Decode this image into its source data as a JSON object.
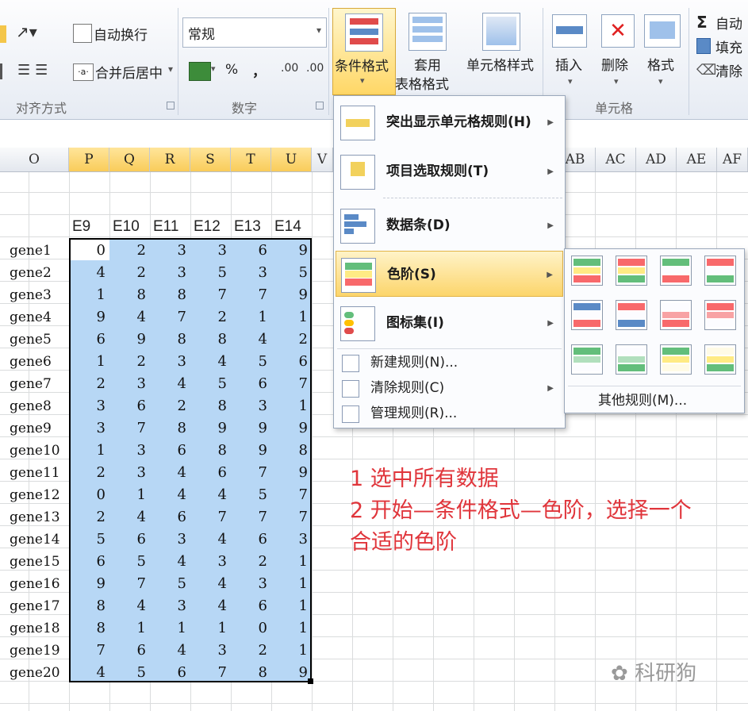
{
  "ribbon": {
    "auto_wrap": "自动换行",
    "merge_center": "合并后居中",
    "merge_arrow": "▾",
    "number_format": "常规",
    "percent": "%",
    "comma": "，",
    "inc_decimal": ".00",
    "dec_decimal": ".00",
    "conditional_format": "条件格式",
    "table_format_line1": "套用",
    "table_format_line2": "表格格式",
    "cell_style": "单元格样式",
    "insert": "插入",
    "delete": "删除",
    "format": "格式",
    "autosum": "自动",
    "fill": "填充",
    "clear": "清除",
    "group_alignment": "对齐方式",
    "group_number": "数字",
    "group_cells": "单元格"
  },
  "columns": [
    "O",
    "P",
    "Q",
    "R",
    "S",
    "T",
    "U",
    "V",
    "AB",
    "AC",
    "AD",
    "AE",
    "AF"
  ],
  "headers": [
    "E9",
    "E10",
    "E11",
    "E12",
    "E13",
    "E14"
  ],
  "rows": [
    {
      "gene": "gene1",
      "values": [
        0,
        2,
        3,
        3,
        6,
        9
      ]
    },
    {
      "gene": "gene2",
      "values": [
        4,
        2,
        3,
        5,
        3,
        5
      ]
    },
    {
      "gene": "gene3",
      "values": [
        1,
        8,
        8,
        7,
        7,
        9
      ]
    },
    {
      "gene": "gene4",
      "values": [
        9,
        4,
        7,
        2,
        1,
        1
      ]
    },
    {
      "gene": "gene5",
      "values": [
        6,
        9,
        8,
        8,
        4,
        2
      ]
    },
    {
      "gene": "gene6",
      "values": [
        1,
        2,
        3,
        4,
        5,
        6
      ]
    },
    {
      "gene": "gene7",
      "values": [
        2,
        3,
        4,
        5,
        6,
        7
      ]
    },
    {
      "gene": "gene8",
      "values": [
        3,
        6,
        2,
        8,
        3,
        1
      ]
    },
    {
      "gene": "gene9",
      "values": [
        3,
        7,
        8,
        9,
        9,
        9
      ]
    },
    {
      "gene": "gene10",
      "values": [
        1,
        3,
        6,
        8,
        9,
        8
      ]
    },
    {
      "gene": "gene11",
      "values": [
        2,
        3,
        4,
        6,
        7,
        9
      ]
    },
    {
      "gene": "gene12",
      "values": [
        0,
        1,
        4,
        4,
        5,
        7
      ]
    },
    {
      "gene": "gene13",
      "values": [
        2,
        4,
        6,
        7,
        7,
        7
      ]
    },
    {
      "gene": "gene14",
      "values": [
        5,
        6,
        3,
        4,
        6,
        3
      ]
    },
    {
      "gene": "gene15",
      "values": [
        6,
        5,
        4,
        3,
        2,
        1
      ]
    },
    {
      "gene": "gene16",
      "values": [
        9,
        7,
        5,
        4,
        3,
        1
      ]
    },
    {
      "gene": "gene17",
      "values": [
        8,
        4,
        3,
        4,
        6,
        1
      ]
    },
    {
      "gene": "gene18",
      "values": [
        8,
        1,
        1,
        1,
        0,
        1
      ]
    },
    {
      "gene": "gene19",
      "values": [
        7,
        6,
        4,
        3,
        2,
        1
      ]
    },
    {
      "gene": "gene20",
      "values": [
        4,
        5,
        6,
        7,
        8,
        9
      ]
    }
  ],
  "menu": {
    "highlight_rules": "突出显示单元格规则(H)",
    "top_bottom_rules": "项目选取规则(T)",
    "data_bars": "数据条(D)",
    "color_scales": "色阶(S)",
    "icon_sets": "图标集(I)",
    "new_rule": "新建规则(N)...",
    "clear_rules": "清除规则(C)",
    "manage_rules": "管理规则(R)..."
  },
  "submenu": {
    "more_rules": "其他规则(M)...",
    "scales": [
      [
        "#63be7b",
        "#ffeb84",
        "#f8696b"
      ],
      [
        "#f8696b",
        "#ffeb84",
        "#63be7b"
      ],
      [
        "#63be7b",
        "#fcfcff",
        "#f8696b"
      ],
      [
        "#f8696b",
        "#fcfcff",
        "#63be7b"
      ],
      [
        "#5a8ac6",
        "#fcfcff",
        "#f8696b"
      ],
      [
        "#f8696b",
        "#fcfcff",
        "#5a8ac6"
      ],
      [
        "#fcfcff",
        "#f8a3a4",
        "#f8696b"
      ],
      [
        "#f8696b",
        "#f8a3a4",
        "#fcfcff"
      ],
      [
        "#63be7b",
        "#b1dfbd",
        "#fcfcff"
      ],
      [
        "#fcfcff",
        "#b1dfbd",
        "#63be7b"
      ],
      [
        "#63be7b",
        "#ffeb84",
        "#fffbe6"
      ],
      [
        "#fffbe6",
        "#ffeb84",
        "#63be7b"
      ]
    ]
  },
  "annotation": {
    "line1": "1 选中所有数据",
    "line2": "2 开始—条件格式—色阶，选择一个",
    "line3": "合适的色阶"
  },
  "watermark": "科研狗"
}
